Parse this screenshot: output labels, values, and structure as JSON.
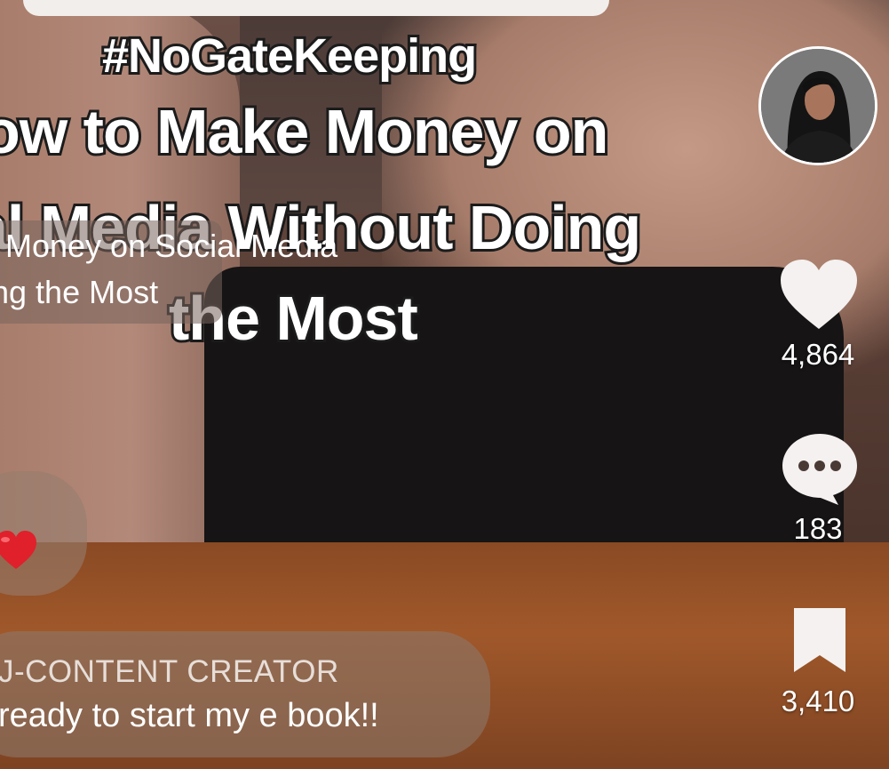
{
  "overlay_caption": {
    "hashtag": "#NoGateKeeping",
    "line_1": "ow to Make Money on",
    "line_2": "al Media Without Doing",
    "line_3": "the Most"
  },
  "video_title": {
    "line_1": "Money on Social Media",
    "line_2": "ng the Most"
  },
  "comments": [
    {
      "type": "emoji",
      "icon": "red-heart-emoji"
    },
    {
      "type": "text",
      "user": "J-CONTENT CREATOR",
      "text": "ready to start my e book!!"
    }
  ],
  "actions": {
    "avatar_icon": "creator-avatar",
    "like": {
      "icon": "heart-icon",
      "count": "4,864"
    },
    "comment": {
      "icon": "speech-bubble-icon",
      "count": "183"
    },
    "bookmark": {
      "icon": "bookmark-icon",
      "count": "3,410"
    }
  },
  "colors": {
    "overlay_text": "#ffffff",
    "caption_stroke": "#1b1b1b",
    "heart_emoji": "#e0202a"
  }
}
